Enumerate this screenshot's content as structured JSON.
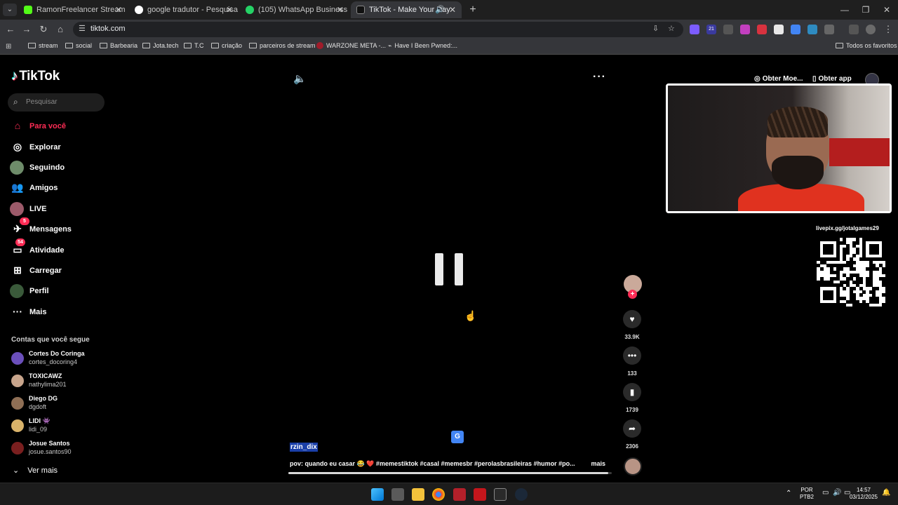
{
  "browser": {
    "tabs": [
      {
        "title": "RamonFreelancer Stream - Wat",
        "color": "#53fc18"
      },
      {
        "title": "google tradutor - Pesquisa Goo",
        "color": "#4285f4"
      },
      {
        "title": "(105) WhatsApp Business",
        "color": "#25d366"
      },
      {
        "title": "TikTok - Make Your Day",
        "color": "#000000"
      }
    ],
    "url": "tiktok.com",
    "bookmarks": [
      "stream",
      "social",
      "Barbearia",
      "Jota.tech",
      "T.C",
      "criação",
      "parceiros de stream",
      "WARZONE META -...",
      "Have I Been Pwned:..."
    ],
    "all_bookmarks": "Todos os favoritos",
    "ext_badge": "21"
  },
  "tiktok": {
    "logo": "TikTok",
    "search_placeholder": "Pesquisar",
    "nav": [
      {
        "label": "Para você",
        "icon": "home-icon",
        "active": true
      },
      {
        "label": "Explorar",
        "icon": "compass-icon"
      },
      {
        "label": "Seguindo",
        "icon": "avatar"
      },
      {
        "label": "Amigos",
        "icon": "friends-icon"
      },
      {
        "label": "LIVE",
        "icon": "avatar"
      },
      {
        "label": "Mensagens",
        "icon": "message-icon",
        "badge": "5"
      },
      {
        "label": "Atividade",
        "icon": "activity-icon",
        "badge": "54"
      },
      {
        "label": "Carregar",
        "icon": "upload-icon"
      },
      {
        "label": "Perfil",
        "icon": "avatar"
      },
      {
        "label": "Mais",
        "icon": "more-icon"
      }
    ],
    "following_title": "Contas que você segue",
    "accounts": [
      {
        "name": "Cortes Do Coringa",
        "user": "cortes_docoring4",
        "color": "#6b4fbb"
      },
      {
        "name": "TOXICAWZ",
        "user": "nathylima201",
        "color": "#c8a58c"
      },
      {
        "name": "Diego DG",
        "user": "dgdoft",
        "color": "#8f6f55"
      },
      {
        "name": "LIDI 👾",
        "user": "lidi_09",
        "color": "#d9b36a"
      },
      {
        "name": "Josue Santos",
        "user": "josue.santos90",
        "color": "#7a1f1f"
      }
    ],
    "see_more": "Ver mais",
    "get_coins": "Obter Moe...",
    "get_app": "Obter app",
    "video": {
      "author": "rzin_dix",
      "description": "pov: quando eu casar 😂 ❤️ #memestiktok #casal #memesbr #perolasbrasileiras #humor #po...",
      "more": "mais",
      "progress": 0.99,
      "likes": "33.9K",
      "comments": "133",
      "saves": "1739",
      "shares": "2306"
    }
  },
  "overlay": {
    "livepix": "livepix.gg/jotalgames29"
  },
  "taskbar": {
    "lang": "POR",
    "layout": "PTB2",
    "time": "14:57",
    "date": "03/12/2025"
  }
}
